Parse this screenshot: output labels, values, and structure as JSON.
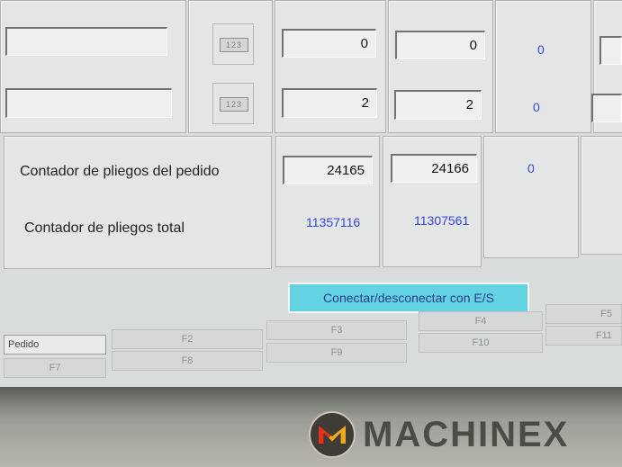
{
  "rows": [
    {
      "calc_label": "123",
      "col1_value": "0",
      "col2_value": "0",
      "col3_value": "0"
    },
    {
      "calc_label": "123",
      "col1_value": "2",
      "col2_value": "2",
      "col3_value": "0"
    }
  ],
  "counters": {
    "order_label": "Contador de pliegos del pedido",
    "order_col1": "24165",
    "order_col2": "24166",
    "order_col3": "0",
    "total_label": "Contador de pliegos total",
    "total_col1": "11357116",
    "total_col2": "11307561"
  },
  "connect_button": "Conectar/desconectar con E/S",
  "function_keys": {
    "pedido": "Pedido",
    "f2": "F2",
    "f3": "F3",
    "f4": "F4",
    "f5": "F5",
    "f7": "F7",
    "f8": "F8",
    "f9": "F9",
    "f10": "F10",
    "f11": "F11"
  },
  "watermark": "MACHINEX",
  "colors": {
    "value_blue": "#3a44d8",
    "button_cyan": "#63d2e3",
    "screen_bg": "#d8dcdb"
  }
}
